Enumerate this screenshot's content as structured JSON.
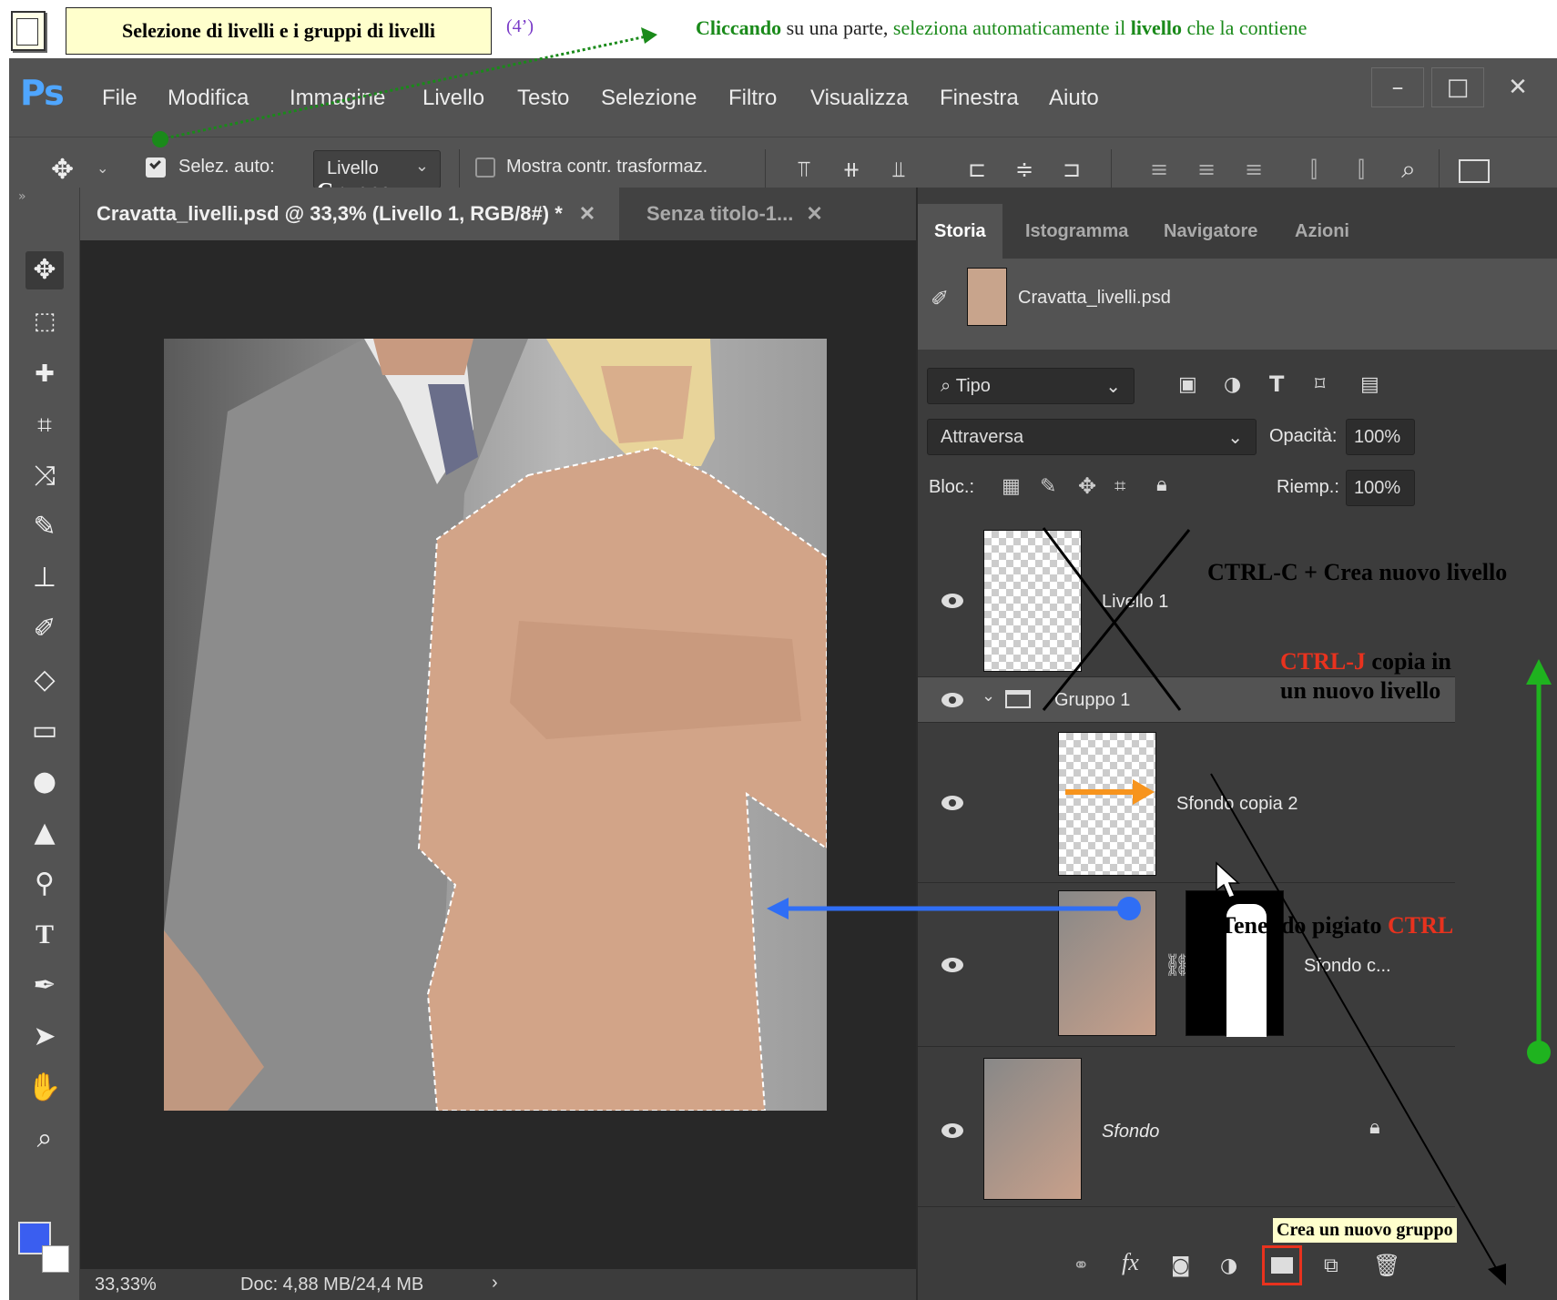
{
  "header": {
    "title": "Selezione di livelli e i gruppi di livelli",
    "duration": "(4’)",
    "note_bold1": "Cliccando",
    "note_mid1": " su una parte, ",
    "note_green": "seleziona automaticamente il ",
    "note_bold2": "livello",
    "note_end": " che la contiene"
  },
  "menubar": {
    "logo": "Ps",
    "items": [
      "File",
      "Modifica",
      "Immagine",
      "Livello",
      "Testo",
      "Selezione",
      "Filtro",
      "Visualizza",
      "Finestra",
      "Aiuto"
    ],
    "min": "–",
    "max": "□",
    "close": "✕"
  },
  "options": {
    "auto_select_label": "Selez. auto:",
    "auto_select_value": "Livello",
    "gruppo_note": "Gruppo",
    "show_transform": "Mostra contr. trasformaz."
  },
  "document": {
    "tab_active": "Cravatta_livelli.psd @ 33,3% (Livello 1, RGB/8#) *",
    "tab_other": "Senza titolo-1...",
    "zoom": "33,33%",
    "doc_size": "Doc: 4,88 MB/24,4 MB"
  },
  "panel": {
    "tabs": [
      "Storia",
      "Istogramma",
      "Navigatore",
      "Azioni"
    ],
    "history_item": "Cravatta_livelli.psd",
    "filter_type": "Tipo",
    "blend_mode": "Attraversa",
    "opacity_label": "Opacità:",
    "opacity_value": "100%",
    "lock_label": "Bloc.:",
    "fill_label": "Riemp.:",
    "fill_value": "100%",
    "layers": [
      {
        "name": "Livello 1"
      },
      {
        "name": "Gruppo 1"
      },
      {
        "name": "Sfondo copia 2"
      },
      {
        "name": "Sfondo c..."
      },
      {
        "name": "Sfondo"
      }
    ]
  },
  "annotations": {
    "ctrl_c": "CTRL-C + Crea nuovo livello",
    "ctrl_j_red": "CTRL-J",
    "ctrl_j_rest": " copia in",
    "ctrl_j_line2": "un nuovo livello",
    "tenendo": "Tenendo pigiato ",
    "tenendo_red": "CTRL",
    "crea_gruppo": "Crea un nuovo gruppo"
  },
  "colors": {
    "ps_blue": "#4fa6ff",
    "annotation_green": "#1a8a1a",
    "annotation_red": "#e8321e",
    "orange_arrow": "#f7941d",
    "blue_arrow": "#2f6ef5"
  }
}
